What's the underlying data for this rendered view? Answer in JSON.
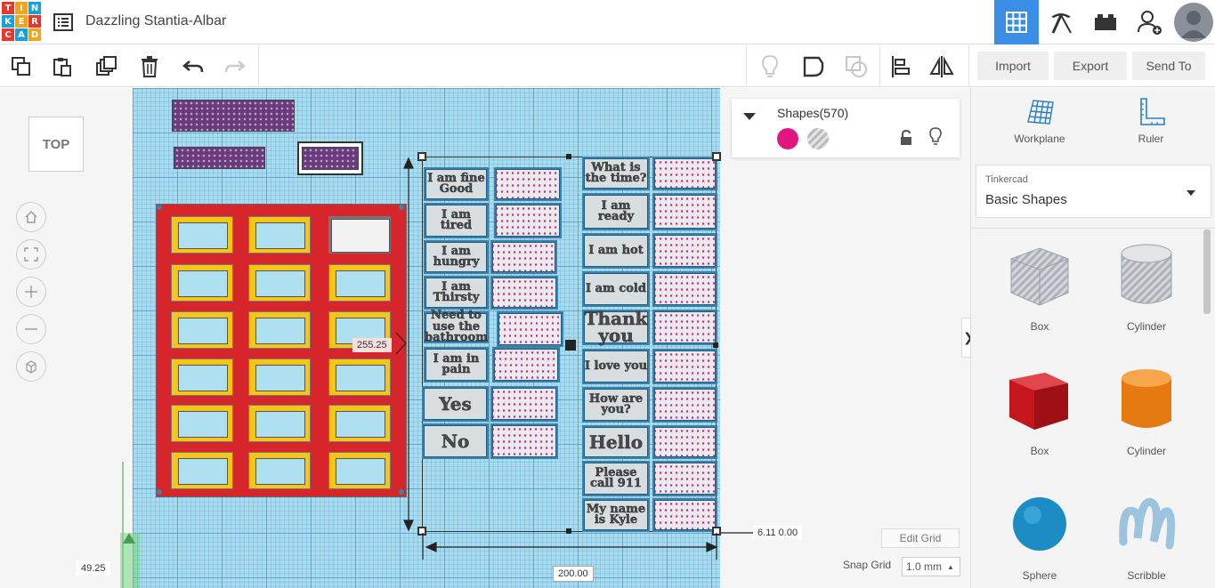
{
  "app": {
    "logo_letters": [
      "T",
      "I",
      "N",
      "K",
      "E",
      "R",
      "C",
      "A",
      "D"
    ],
    "logo_colors": [
      "#e8362a",
      "#f0a41c",
      "#16a0dc",
      "#16a0dc",
      "#f0a41c",
      "#e8362a",
      "#e8362a",
      "#16a0dc",
      "#f0a41c"
    ],
    "design_title": "Dazzling Stantia-Albar"
  },
  "header": {
    "buttons": [
      {
        "name": "3d-design-view",
        "icon": "grid-icon",
        "active": true
      },
      {
        "name": "codeblocks-view",
        "icon": "pickaxe-icon",
        "active": false
      },
      {
        "name": "bricks-view",
        "icon": "brick-icon",
        "active": false
      },
      {
        "name": "add-user",
        "icon": "add-user-icon",
        "active": false
      },
      {
        "name": "profile",
        "icon": "avatar-icon",
        "active": false
      }
    ]
  },
  "toolbar": {
    "import_label": "Import",
    "export_label": "Export",
    "send_to_label": "Send To"
  },
  "viewcube": {
    "label": "TOP"
  },
  "inspector": {
    "title": "Shapes(570)",
    "solid_color": "#e0177f"
  },
  "canvas": {
    "height_dim": "255.25",
    "width_dim": "200.00",
    "right_dim": "6.11 0.00",
    "elevation_dim": "49.25",
    "edit_grid_label": "Edit Grid",
    "snap_grid_label": "Snap Grid",
    "snap_grid_value": "1.0 mm"
  },
  "cards_left": [
    "I am fine Good",
    "I am tired",
    "I am hungry",
    "I am Thirsty",
    "Need to use the bathroom",
    "I am in pain",
    "Yes",
    "No"
  ],
  "cards_right": [
    "What is the time?",
    "I am ready",
    "I am hot",
    "I am cold",
    "Thank you",
    "I love you",
    "How are you?",
    "Hello",
    "Please call 911",
    "My name is Kyle"
  ],
  "rightpanel": {
    "workplane_label": "Workplane",
    "ruler_label": "Ruler",
    "library_small": "Tinkercad",
    "library_name": "Basic Shapes",
    "shapes": [
      {
        "name": "Box",
        "style": "hole"
      },
      {
        "name": "Cylinder",
        "style": "hole"
      },
      {
        "name": "Box",
        "style": "red"
      },
      {
        "name": "Cylinder",
        "style": "orange"
      },
      {
        "name": "Sphere",
        "style": "blue"
      },
      {
        "name": "Scribble",
        "style": "scribble"
      }
    ]
  }
}
